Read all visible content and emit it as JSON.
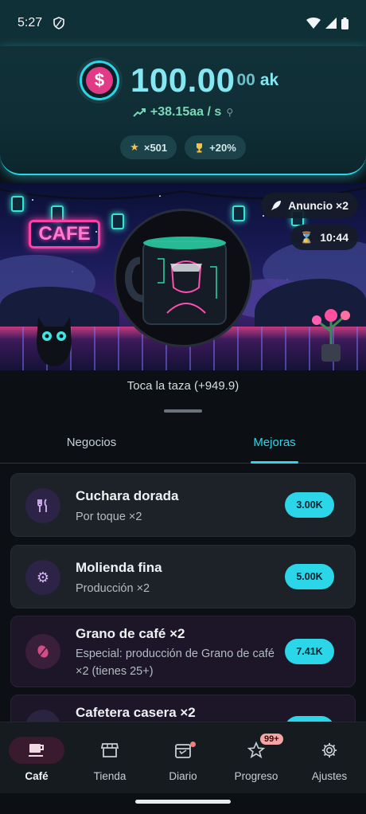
{
  "status_bar": {
    "time": "5:27"
  },
  "header": {
    "balance_main": "100.00",
    "balance_small": "00",
    "balance_unit": "ak",
    "rate": "+38.15aa / s",
    "chips": [
      {
        "icon": "star-icon",
        "label": "×501"
      },
      {
        "icon": "trophy-icon",
        "label": "+20%"
      }
    ]
  },
  "scene": {
    "neon_sign": "CAFE",
    "ad_badge": "Anuncio ×2",
    "timer": "10:44",
    "tap_text": "Toca la taza  (+949.9)"
  },
  "tabs": [
    {
      "label": "Negocios",
      "active": false
    },
    {
      "label": "Mejoras",
      "active": true
    }
  ],
  "upgrades": [
    {
      "icon": "utensils-icon",
      "title": "Cuchara dorada",
      "subtitle": "Por toque ×2",
      "price": "3.00K"
    },
    {
      "icon": "gear-icon",
      "title": "Molienda fina",
      "subtitle": "Producción ×2",
      "price": "5.00K"
    },
    {
      "icon": "coffee-bean-icon",
      "title": "Grano de café ×2",
      "subtitle": "Especial: producción de Grano de café ×2 (tienes 25+)",
      "price": "7.41K"
    },
    {
      "icon": "coffee-maker-icon",
      "title": "Cafetera casera ×2",
      "subtitle": "",
      "price": ""
    }
  ],
  "bottom_nav": [
    {
      "icon": "coffee-cup-icon",
      "label": "Café",
      "active": true
    },
    {
      "icon": "store-icon",
      "label": "Tienda"
    },
    {
      "icon": "calendar-icon",
      "label": "Diario"
    },
    {
      "icon": "star-outline-icon",
      "label": "Progreso",
      "badge": "99+"
    },
    {
      "icon": "settings-icon",
      "label": "Ajustes"
    }
  ],
  "colors": {
    "accent": "#2bd6e8",
    "neon_pink": "#ff3fa8",
    "card_bg": "#1c2227"
  }
}
